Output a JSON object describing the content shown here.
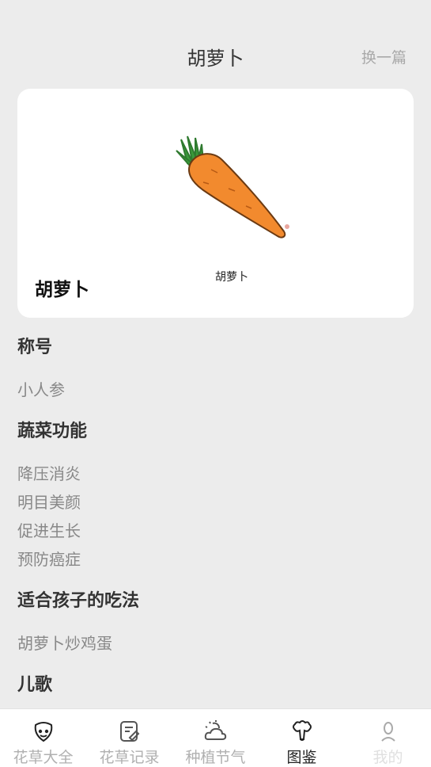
{
  "header": {
    "title": "胡萝卜",
    "switch_label": "换一篇"
  },
  "card": {
    "name": "胡萝卜",
    "illustration_caption": "胡萝卜",
    "illustration_icon": "carrot-illustration",
    "colors": {
      "carrot": "#f28a2e",
      "leaves": "#3a9a3a"
    }
  },
  "sections": {
    "nickname": {
      "title": "称号",
      "lines": [
        "小人参"
      ]
    },
    "functions": {
      "title": "蔬菜功能",
      "lines": [
        "降压消炎",
        "明目美颜",
        "促进生长",
        "预防癌症"
      ]
    },
    "kids_recipe": {
      "title": "适合孩子的吃法",
      "lines": [
        "胡萝卜炒鸡蛋"
      ]
    },
    "nursery_rhyme": {
      "title": "儿歌"
    }
  },
  "tabbar": {
    "active": "图鉴",
    "items": [
      {
        "label": "花草大全",
        "icon": "flower-face-icon"
      },
      {
        "label": "花草记录",
        "icon": "edit-note-icon"
      },
      {
        "label": "种植节气",
        "icon": "sun-cloud-icon"
      },
      {
        "label": "图鉴",
        "icon": "broccoli-icon"
      },
      {
        "label": "我的",
        "icon": "user-icon"
      }
    ]
  }
}
